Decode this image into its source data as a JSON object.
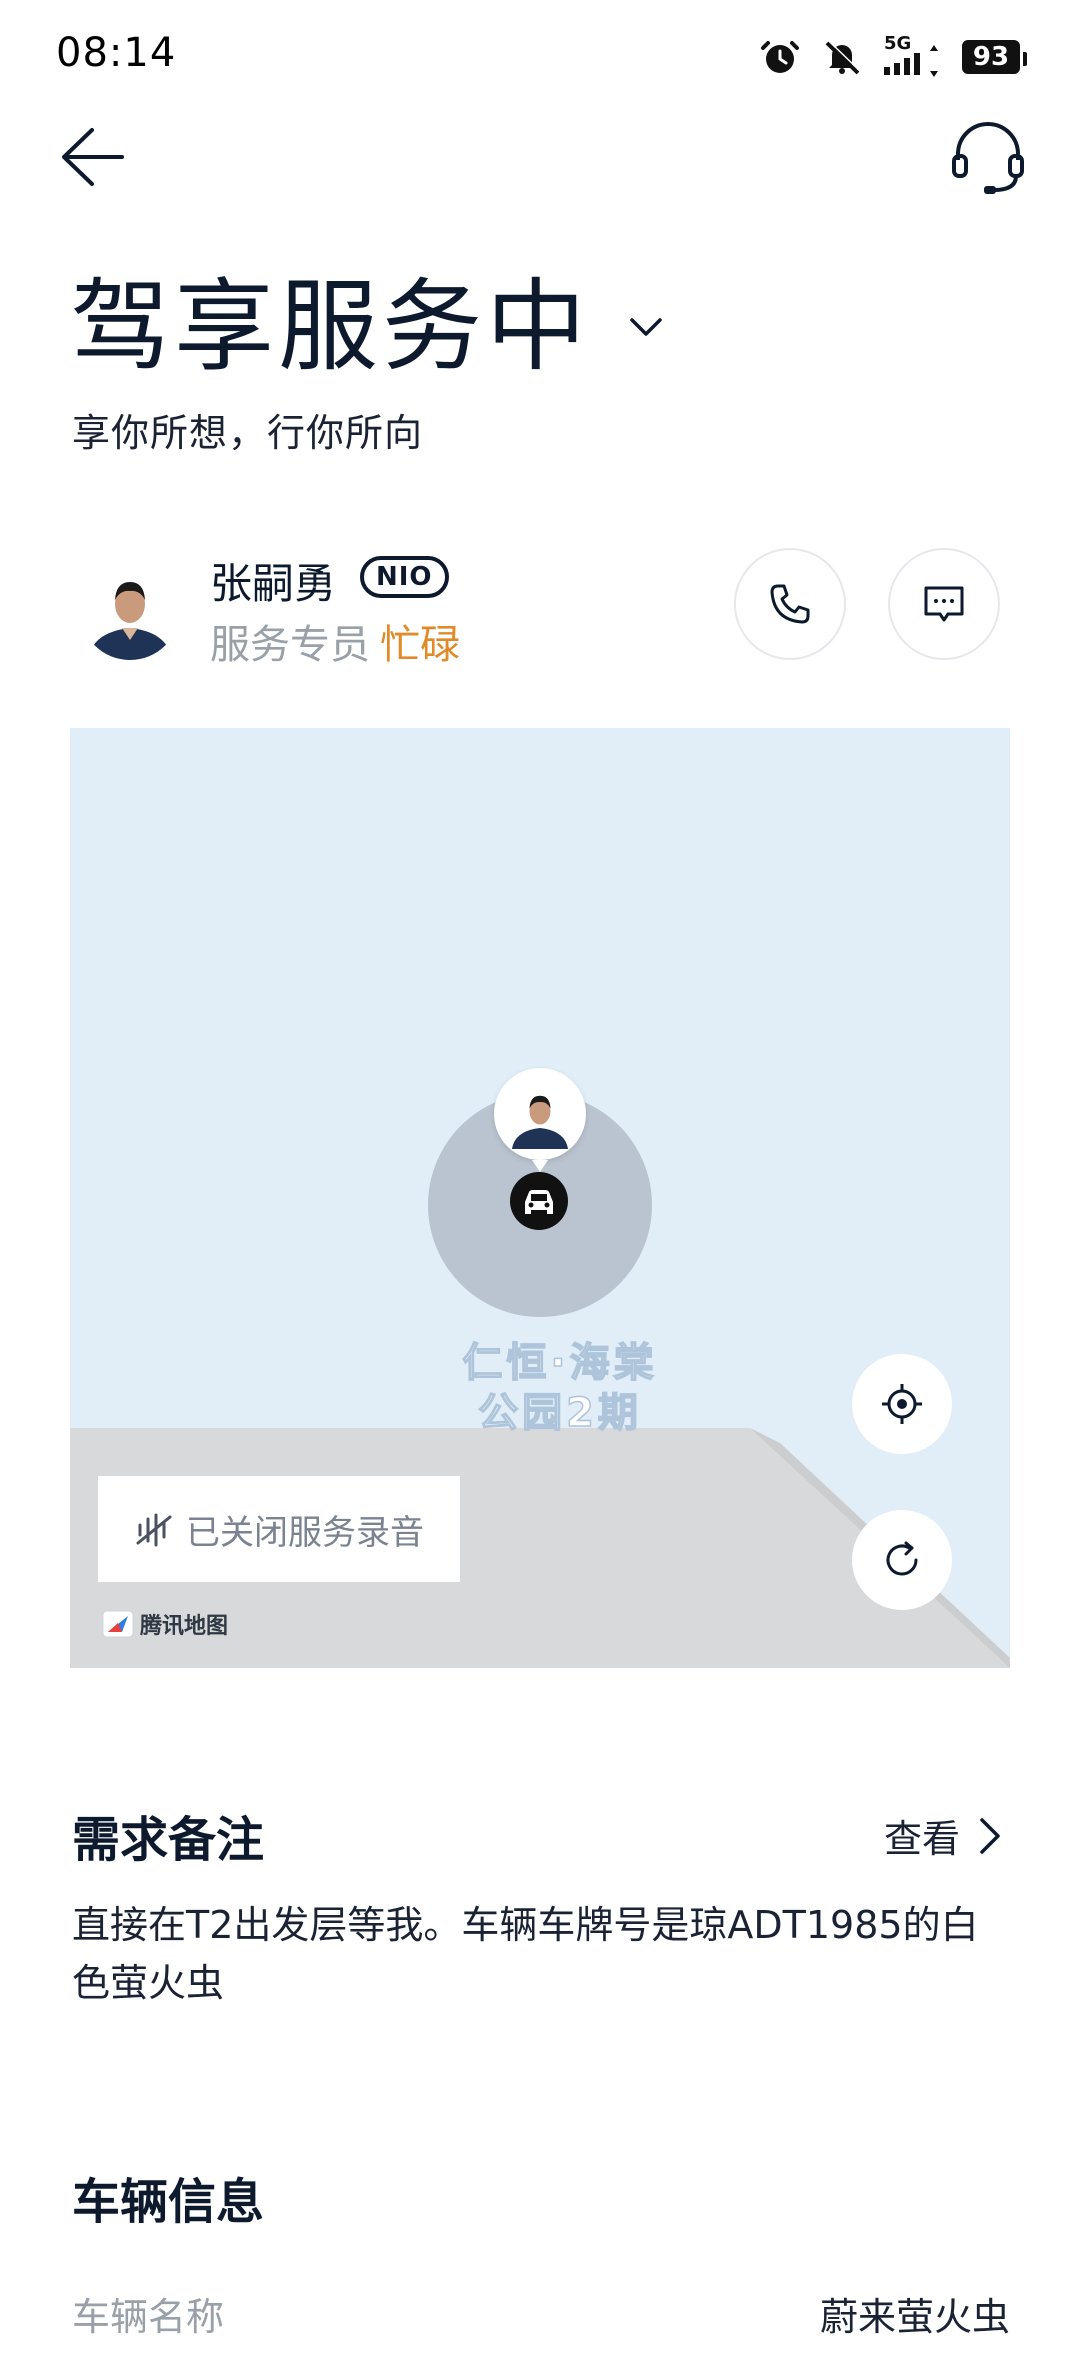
{
  "status_bar": {
    "time": "08:14",
    "network": "5G",
    "battery": "93"
  },
  "header": {
    "title": "驾享服务中",
    "subtitle": "享你所想，行你所向"
  },
  "driver": {
    "name": "张嗣勇",
    "badge": "NIO",
    "role": "服务专员",
    "status": "忙碌",
    "status_color": "#e08a28"
  },
  "map": {
    "poi_line1": "仁恒·海棠",
    "poi_line2": "公园2期",
    "recording_status": "已关闭服务录音",
    "attribution": "腾讯地图",
    "water_color": "#e1eef8",
    "land_color": "#d9dbdc"
  },
  "notes": {
    "title": "需求备注",
    "view_label": "查看",
    "text": "直接在T2出发层等我。车辆车牌号是琼ADT1985的白色萤火虫"
  },
  "vehicle": {
    "title": "车辆信息",
    "name_label": "车辆名称",
    "name_value": "蔚来萤火虫"
  },
  "icons": {
    "back": "arrow-left-icon",
    "support": "headset-icon",
    "chevron": "chevron-down-icon",
    "call": "phone-icon",
    "message": "message-icon",
    "locate": "locate-icon",
    "refresh": "refresh-icon",
    "car": "car-icon",
    "recording": "waveform-mute-icon"
  }
}
